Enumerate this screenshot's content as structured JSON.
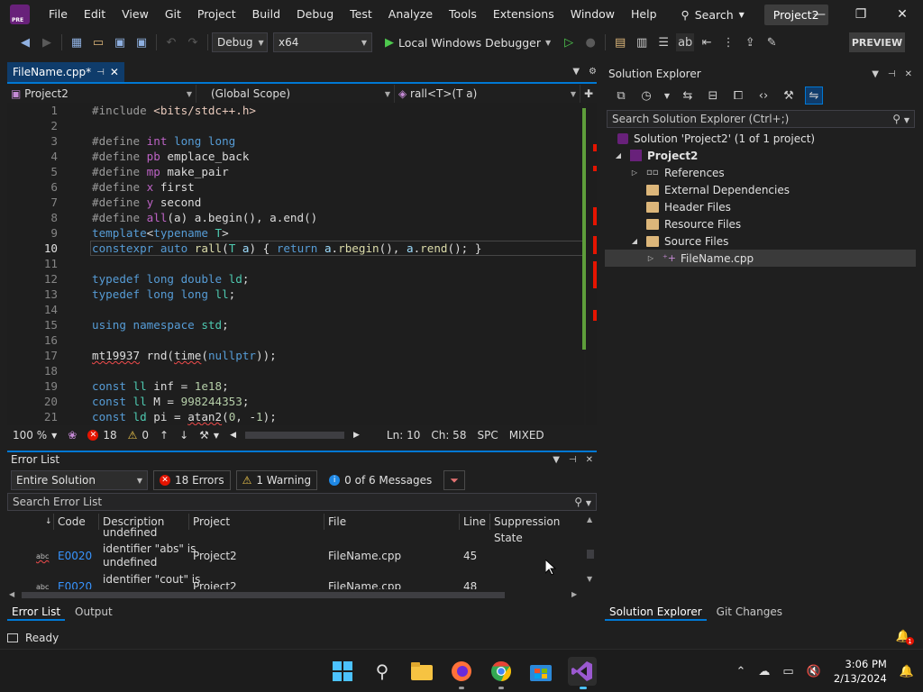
{
  "menu": [
    "File",
    "Edit",
    "View",
    "Git",
    "Project",
    "Build",
    "Debug",
    "Test",
    "Analyze",
    "Tools",
    "Extensions",
    "Window",
    "Help"
  ],
  "search_label": "Search",
  "project_badge": "Project2",
  "toolbar": {
    "config": "Debug",
    "platform": "x64",
    "run_label": "Local Windows Debugger",
    "preview_label": "PREVIEW"
  },
  "editor": {
    "tab_label": "FileName.cpp*",
    "nav_project": "Project2",
    "nav_scope": "(Global Scope)",
    "nav_member": "rall<T>(T a)",
    "current_line": 10,
    "lines": [
      {
        "n": "1",
        "text": "#include <bits/stdc++.h>"
      },
      {
        "n": "2",
        "text": ""
      },
      {
        "n": "3",
        "text": "#define int long long"
      },
      {
        "n": "4",
        "text": "#define pb emplace_back"
      },
      {
        "n": "5",
        "text": "#define mp make_pair"
      },
      {
        "n": "6",
        "text": "#define x first"
      },
      {
        "n": "7",
        "text": "#define y second"
      },
      {
        "n": "8",
        "text": "#define all(a) a.begin(), a.end()"
      },
      {
        "n": "9",
        "text": "template<typename T>"
      },
      {
        "n": "10",
        "text": "constexpr auto rall(T a) { return a.rbegin(), a.rend(); }"
      },
      {
        "n": "11",
        "text": ""
      },
      {
        "n": "12",
        "text": "typedef long double ld;"
      },
      {
        "n": "13",
        "text": "typedef long long ll;"
      },
      {
        "n": "14",
        "text": ""
      },
      {
        "n": "15",
        "text": "using namespace std;"
      },
      {
        "n": "16",
        "text": ""
      },
      {
        "n": "17",
        "text": "mt19937 rnd(time(nullptr));"
      },
      {
        "n": "18",
        "text": ""
      },
      {
        "n": "19",
        "text": "const ll inf = 1e18;"
      },
      {
        "n": "20",
        "text": "const ll M = 998244353;"
      },
      {
        "n": "21",
        "text": "const ld pi = atan2(0, -1);"
      }
    ],
    "status": {
      "zoom": "100 %",
      "errors": "18",
      "warnings": "0",
      "ln": "Ln: 10",
      "ch": "Ch: 58",
      "spc": "SPC",
      "eol": "MIXED"
    }
  },
  "error_list": {
    "title": "Error List",
    "scope": "Entire Solution",
    "errors_btn": "18 Errors",
    "warnings_btn": "1 Warning",
    "messages_btn": "0 of 6 Messages",
    "search_placeholder": "Search Error List",
    "columns": [
      "Code",
      "Description",
      "Project",
      "File",
      "Line",
      "Suppression State"
    ],
    "partial_top": "undefined",
    "rows": [
      {
        "code": "E0020",
        "desc1": "identifier \"abs\" is",
        "desc2": "undefined",
        "project": "Project2",
        "file": "FileName.cpp",
        "line": "45"
      },
      {
        "code": "E0020",
        "desc1": "identifier \"cout\" is",
        "desc2": "",
        "project": "Project2",
        "file": "FileName.cpp",
        "line": "48"
      }
    ],
    "tabs": [
      "Error List",
      "Output"
    ]
  },
  "solution_explorer": {
    "title": "Solution Explorer",
    "search_placeholder": "Search Solution Explorer (Ctrl+;)",
    "solution_label": "Solution 'Project2' (1 of 1 project)",
    "project_label": "Project2",
    "nodes": [
      "References",
      "External Dependencies",
      "Header Files",
      "Resource Files",
      "Source Files"
    ],
    "file_label": "FileName.cpp",
    "tabs": [
      "Solution Explorer",
      "Git Changes"
    ]
  },
  "statusbar": {
    "ready": "Ready"
  },
  "clock": {
    "time": "3:06 PM",
    "date": "2/13/2024"
  }
}
